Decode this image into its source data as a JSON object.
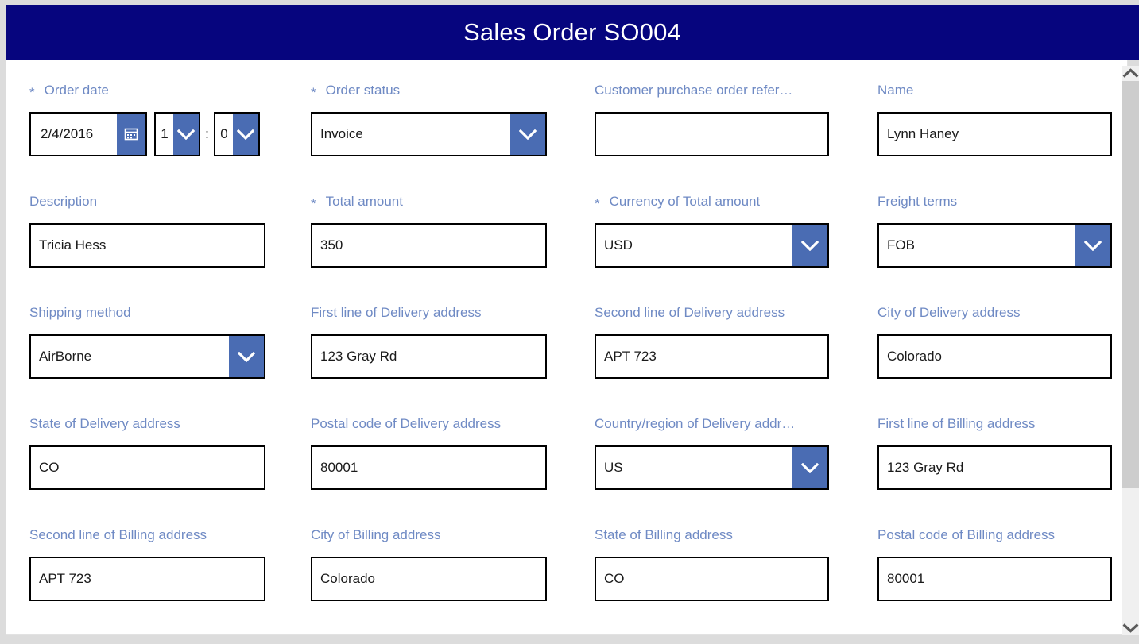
{
  "header": {
    "title": "Sales Order SO004"
  },
  "colors": {
    "header_background": "#06057e",
    "header_text": "#ffffff",
    "label": "#6f8ac4",
    "accent_button": "#4a6cb3",
    "input_border": "#000000",
    "page_background": "#dcdcdc",
    "surface": "#ffffff",
    "scrollbar_thumb": "#cdcdcd",
    "scrollbar_track": "#f0f0f0"
  },
  "icons": {
    "calendar": "calendar-icon",
    "chevron_down": "chevron-down-icon",
    "scroll_up": "chevron-up-icon",
    "scroll_down": "chevron-down-icon"
  },
  "form": {
    "required_marker": "*",
    "time_separator": ":",
    "rows": [
      {
        "fields": [
          {
            "name": "order-date",
            "label": "Order date",
            "required": true,
            "type": "datetime",
            "date_value": "2/4/2016",
            "hour_value": "1",
            "minute_value": "0"
          },
          {
            "name": "order-status",
            "label": "Order status",
            "required": true,
            "type": "select",
            "value": "Invoice"
          },
          {
            "name": "customer-purchase-order-reference",
            "label": "Customer purchase order refer…",
            "required": false,
            "type": "text",
            "value": ""
          },
          {
            "name": "name",
            "label": "Name",
            "required": false,
            "type": "text",
            "value": "Lynn Haney"
          }
        ]
      },
      {
        "fields": [
          {
            "name": "description",
            "label": "Description",
            "required": false,
            "type": "text",
            "value": "Tricia Hess"
          },
          {
            "name": "total-amount",
            "label": "Total amount",
            "required": true,
            "type": "text",
            "value": "350"
          },
          {
            "name": "currency-of-total-amount",
            "label": "Currency of Total amount",
            "required": true,
            "type": "select",
            "value": "USD"
          },
          {
            "name": "freight-terms",
            "label": "Freight terms",
            "required": false,
            "type": "select",
            "value": "FOB"
          }
        ]
      },
      {
        "fields": [
          {
            "name": "shipping-method",
            "label": "Shipping method",
            "required": false,
            "type": "select",
            "value": "AirBorne"
          },
          {
            "name": "first-line-of-delivery-address",
            "label": "First line of Delivery address",
            "required": false,
            "type": "text",
            "value": "123 Gray Rd"
          },
          {
            "name": "second-line-of-delivery-address",
            "label": "Second line of Delivery address",
            "required": false,
            "type": "text",
            "value": "APT 723"
          },
          {
            "name": "city-of-delivery-address",
            "label": "City of Delivery address",
            "required": false,
            "type": "text",
            "value": "Colorado"
          }
        ]
      },
      {
        "fields": [
          {
            "name": "state-of-delivery-address",
            "label": "State of Delivery address",
            "required": false,
            "type": "text",
            "value": "CO"
          },
          {
            "name": "postal-code-of-delivery-address",
            "label": "Postal code of Delivery address",
            "required": false,
            "type": "text",
            "value": "80001"
          },
          {
            "name": "country-region-of-delivery-address",
            "label": "Country/region of Delivery addr…",
            "required": false,
            "type": "select",
            "value": "US"
          },
          {
            "name": "first-line-of-billing-address",
            "label": "First line of Billing address",
            "required": false,
            "type": "text",
            "value": "123 Gray Rd"
          }
        ]
      },
      {
        "fields": [
          {
            "name": "second-line-of-billing-address",
            "label": "Second line of Billing address",
            "required": false,
            "type": "text",
            "value": "APT 723"
          },
          {
            "name": "city-of-billing-address",
            "label": "City of Billing address",
            "required": false,
            "type": "text",
            "value": "Colorado"
          },
          {
            "name": "state-of-billing-address",
            "label": "State of Billing address",
            "required": false,
            "type": "text",
            "value": "CO"
          },
          {
            "name": "postal-code-of-billing-address",
            "label": "Postal code of Billing address",
            "required": false,
            "type": "text",
            "value": "80001"
          }
        ]
      }
    ]
  }
}
